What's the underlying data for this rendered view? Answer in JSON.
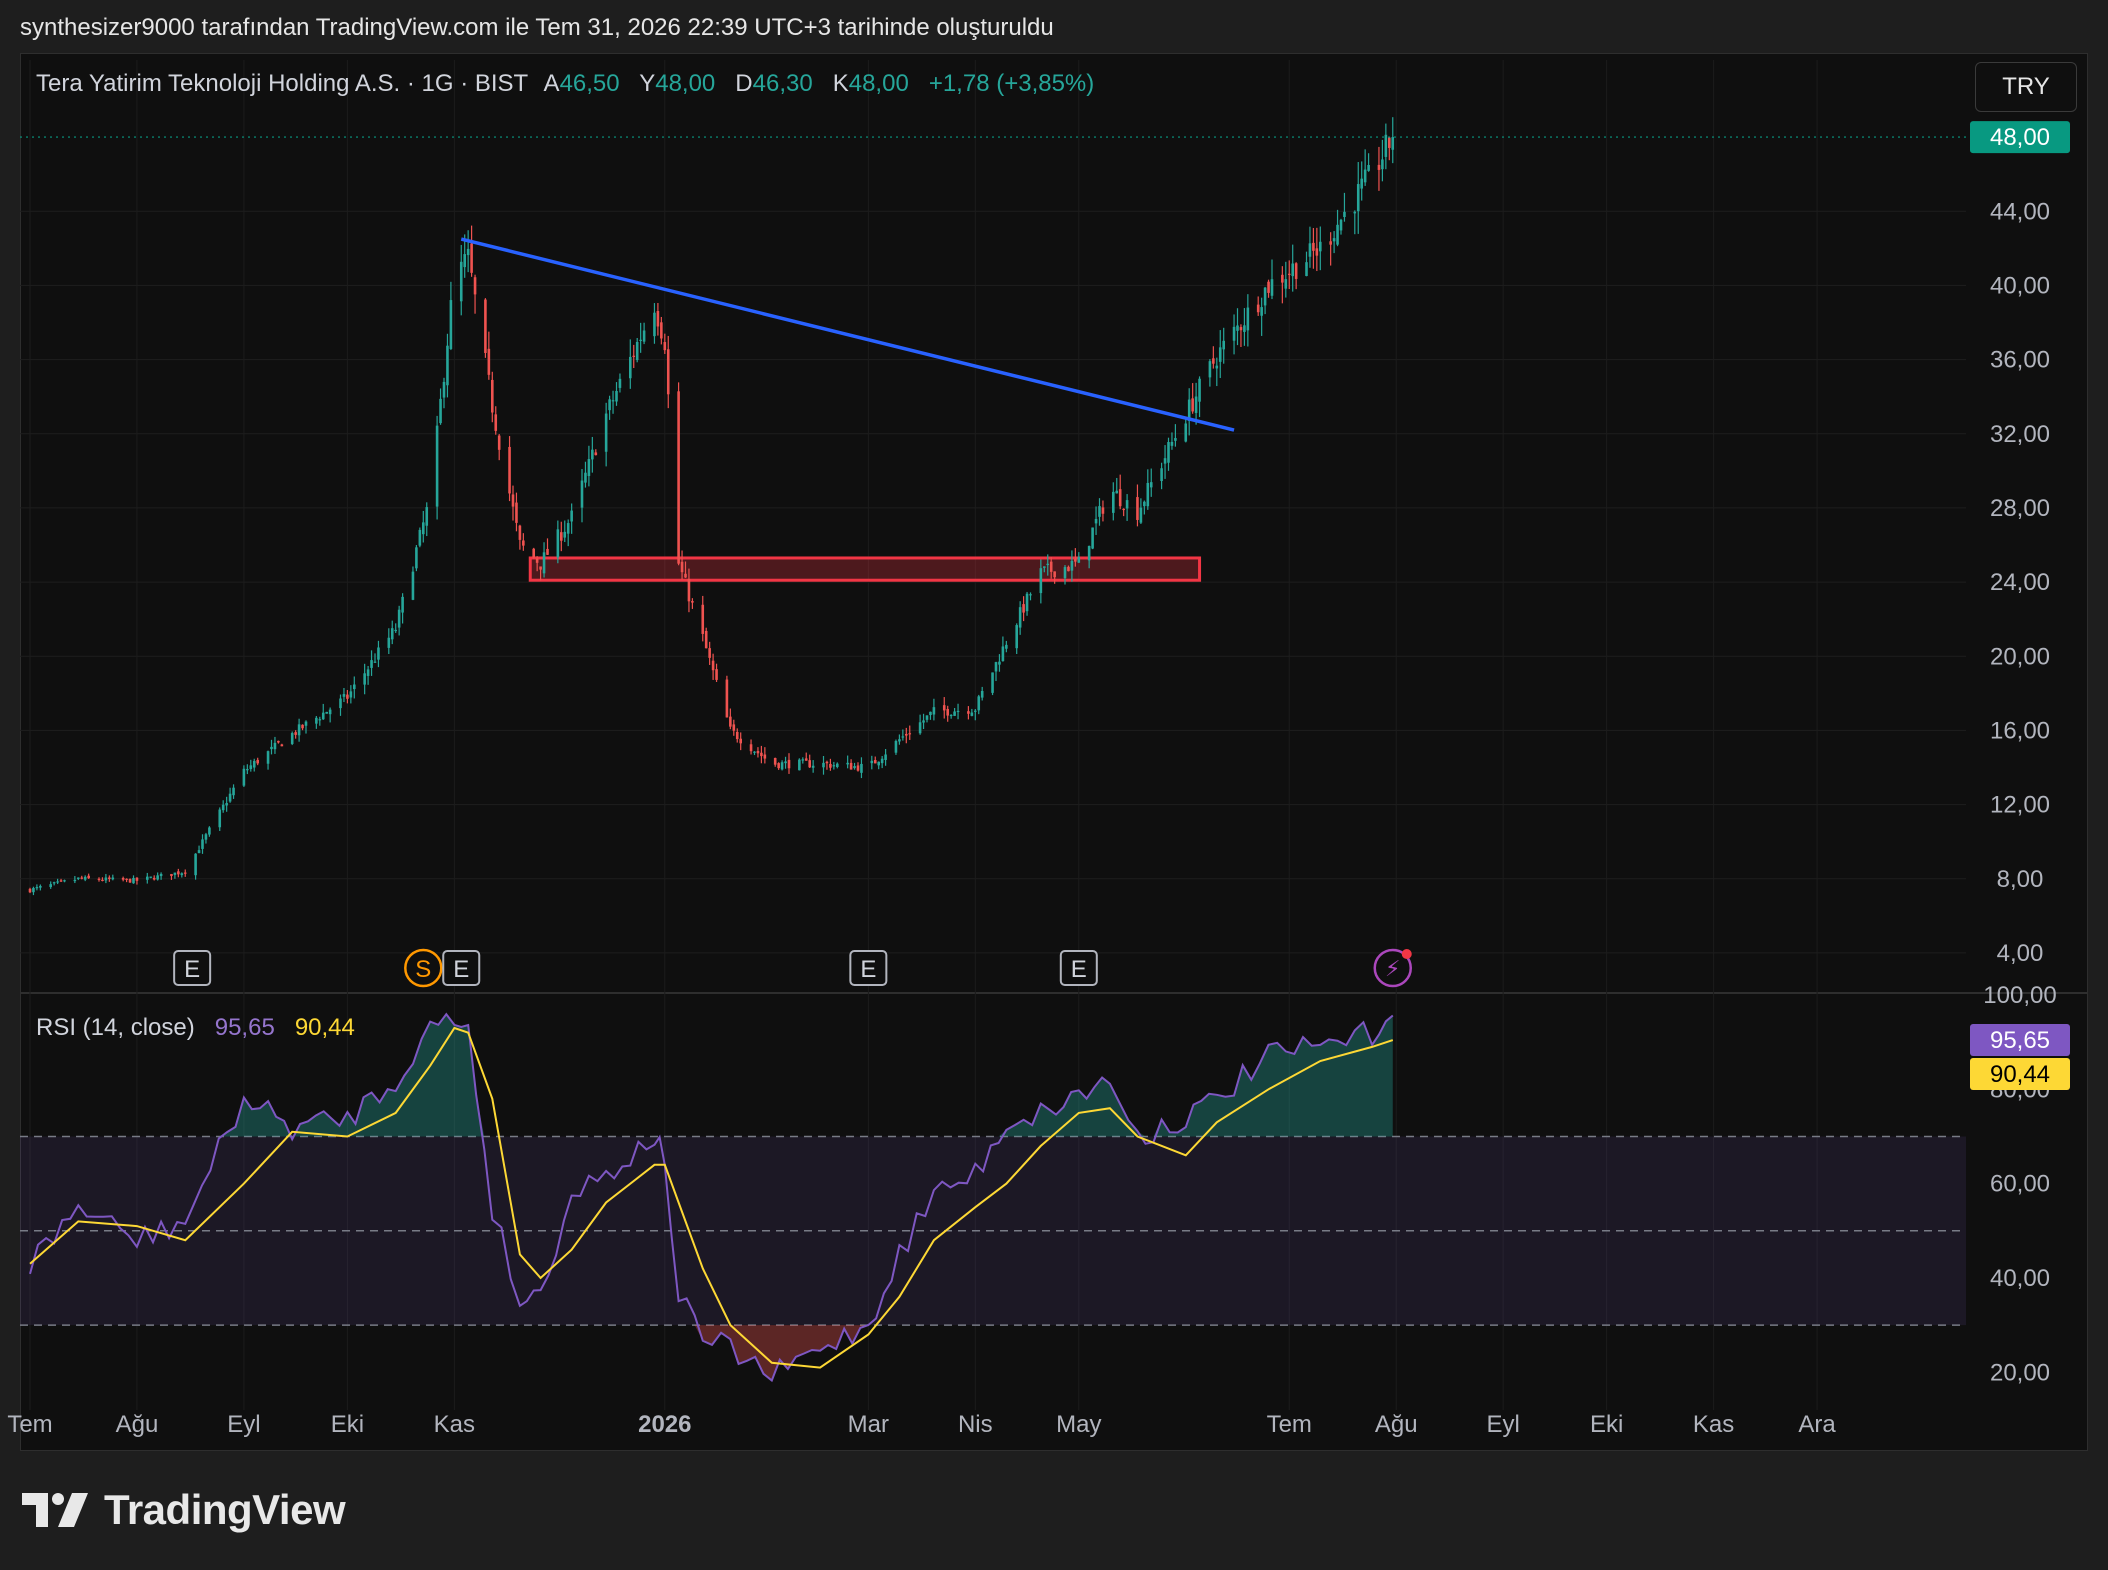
{
  "caption": "synthesizer9000 tarafından TradingView.com ile Tem 31, 2026 22:39 UTC+3 tarihinde oluşturuldu",
  "legend": {
    "title": "Tera Yatirim Teknoloji Holding A.S. · 1G · BIST",
    "open_label": "A",
    "open": "46,50",
    "high_label": "Y",
    "high": "48,00",
    "low_label": "D",
    "low": "46,30",
    "close_label": "K",
    "close": "48,00",
    "change": "+1,78 (+3,85%)"
  },
  "currency_button": "TRY",
  "rsi_legend": {
    "label": "RSI (14, close)",
    "rsi": "95,65",
    "ma": "90,44"
  },
  "brand": "TradingView",
  "colors": {
    "up": "#26a69a",
    "down": "#ef5350",
    "trendline": "#2962ff",
    "zone": "#f23645",
    "rsi": "#7e57c2",
    "rsi_ma": "#fdd835",
    "price_tag": "#089981"
  },
  "chart_data": [
    {
      "type": "candlestick",
      "title": "Tera Yatirim Teknoloji Holding A.S. · 1G · BIST",
      "ylim": [
        2,
        50
      ],
      "y_ticks": [
        "4,00",
        "8,00",
        "12,00",
        "16,00",
        "20,00",
        "24,00",
        "28,00",
        "32,00",
        "36,00",
        "40,00",
        "44,00"
      ],
      "last_price": "48,00",
      "x_ticks": [
        "Tem",
        "Ağu",
        "Eyl",
        "Eki",
        "Kas",
        "2026",
        "Mar",
        "Nis",
        "May",
        "Tem",
        "Ağu",
        "Eyl",
        "Eki",
        "Kas",
        "Ara"
      ],
      "close_path": [
        [
          "2025-07-01",
          7.4
        ],
        [
          "2025-07-15",
          8.0
        ],
        [
          "2025-08-01",
          7.9
        ],
        [
          "2025-08-15",
          8.4
        ],
        [
          "2025-09-01",
          13.8
        ],
        [
          "2025-09-15",
          15.8
        ],
        [
          "2025-10-01",
          17.8
        ],
        [
          "2025-10-15",
          21.5
        ],
        [
          "2025-10-25",
          28.5
        ],
        [
          "2025-11-01",
          40.5
        ],
        [
          "2025-11-05",
          41.5
        ],
        [
          "2025-11-12",
          33.5
        ],
        [
          "2025-11-20",
          26.0
        ],
        [
          "2025-11-26",
          25.0
        ],
        [
          "2025-12-05",
          27.5
        ],
        [
          "2025-12-15",
          33.0
        ],
        [
          "2025-12-29",
          39.0
        ],
        [
          "2026-01-01",
          37.0
        ],
        [
          "2026-01-05",
          25.0
        ],
        [
          "2026-01-12",
          21.0
        ],
        [
          "2026-01-20",
          16.0
        ],
        [
          "2026-02-01",
          14.2
        ],
        [
          "2026-02-15",
          14.2
        ],
        [
          "2026-03-01",
          14.0
        ],
        [
          "2026-03-10",
          15.5
        ],
        [
          "2026-03-20",
          17.0
        ],
        [
          "2026-04-01",
          17.2
        ],
        [
          "2026-04-10",
          20.8
        ],
        [
          "2026-04-20",
          24.5
        ],
        [
          "2026-05-01",
          25.0
        ],
        [
          "2026-05-10",
          29.0
        ],
        [
          "2026-05-18",
          27.8
        ],
        [
          "2026-06-01",
          33.0
        ],
        [
          "2026-06-10",
          36.2
        ],
        [
          "2026-06-25",
          40.0
        ],
        [
          "2026-07-10",
          42.0
        ],
        [
          "2026-07-25",
          46.0
        ],
        [
          "2026-07-31",
          48.0
        ]
      ],
      "annotations": {
        "trendline": {
          "from": [
            "2025-11-03",
            42.5
          ],
          "to": [
            "2026-06-15",
            32.2
          ]
        },
        "support_zone": {
          "from": "2025-11-23",
          "to": "2026-06-05",
          "low": 24.1,
          "high": 25.3
        },
        "events": [
          {
            "label": "E",
            "date": "2025-08-17"
          },
          {
            "label": "S",
            "date": "2025-10-23"
          },
          {
            "label": "E",
            "date": "2025-11-03"
          },
          {
            "label": "E",
            "date": "2026-03-01"
          },
          {
            "label": "E",
            "date": "2026-05-01"
          },
          {
            "label": "⚡",
            "date": "2026-07-31"
          }
        ]
      }
    },
    {
      "type": "line",
      "title": "RSI (14, close)",
      "ylim": [
        12,
        100
      ],
      "y_ticks": [
        "20,00",
        "40,00",
        "60,00",
        "80,00",
        "100,00"
      ],
      "bands": {
        "upper": 70,
        "middle": 50,
        "lower": 30
      },
      "series": [
        {
          "name": "RSI",
          "last": "95,65",
          "values": [
            [
              "2025-07-01",
              43
            ],
            [
              "2025-07-15",
              55
            ],
            [
              "2025-08-01",
              48
            ],
            [
              "2025-08-15",
              52
            ],
            [
              "2025-09-01",
              78
            ],
            [
              "2025-09-15",
              72
            ],
            [
              "2025-10-01",
              74
            ],
            [
              "2025-10-15",
              82
            ],
            [
              "2025-10-25",
              93
            ],
            [
              "2025-11-01",
              95
            ],
            [
              "2025-11-05",
              93
            ],
            [
              "2025-11-12",
              55
            ],
            [
              "2025-11-20",
              35
            ],
            [
              "2025-11-26",
              37
            ],
            [
              "2025-12-05",
              58
            ],
            [
              "2025-12-15",
              62
            ],
            [
              "2025-12-29",
              70
            ],
            [
              "2026-01-01",
              65
            ],
            [
              "2026-01-05",
              36
            ],
            [
              "2026-01-12",
              27
            ],
            [
              "2026-01-20",
              25
            ],
            [
              "2026-02-01",
              19
            ],
            [
              "2026-02-15",
              25
            ],
            [
              "2026-03-01",
              30
            ],
            [
              "2026-03-10",
              45
            ],
            [
              "2026-03-20",
              58
            ],
            [
              "2026-04-01",
              62
            ],
            [
              "2026-04-10",
              73
            ],
            [
              "2026-04-20",
              75
            ],
            [
              "2026-05-01",
              79
            ],
            [
              "2026-05-10",
              82
            ],
            [
              "2026-05-18",
              70
            ],
            [
              "2026-06-01",
              74
            ],
            [
              "2026-06-10",
              78
            ],
            [
              "2026-06-25",
              87
            ],
            [
              "2026-07-10",
              89
            ],
            [
              "2026-07-25",
              92
            ],
            [
              "2026-07-31",
              95.65
            ]
          ]
        },
        {
          "name": "RSI MA",
          "last": "90,44",
          "values": [
            [
              "2025-07-01",
              43
            ],
            [
              "2025-07-15",
              52
            ],
            [
              "2025-08-01",
              51
            ],
            [
              "2025-08-15",
              48
            ],
            [
              "2025-09-01",
              60
            ],
            [
              "2025-09-15",
              71
            ],
            [
              "2025-10-01",
              70
            ],
            [
              "2025-10-15",
              75
            ],
            [
              "2025-10-25",
              85
            ],
            [
              "2025-11-01",
              93
            ],
            [
              "2025-11-05",
              92
            ],
            [
              "2025-11-12",
              78
            ],
            [
              "2025-11-20",
              45
            ],
            [
              "2025-11-26",
              40
            ],
            [
              "2025-12-05",
              46
            ],
            [
              "2025-12-15",
              56
            ],
            [
              "2025-12-29",
              64
            ],
            [
              "2026-01-01",
              64
            ],
            [
              "2026-01-05",
              56
            ],
            [
              "2026-01-12",
              42
            ],
            [
              "2026-01-20",
              30
            ],
            [
              "2026-02-01",
              22
            ],
            [
              "2026-02-15",
              21
            ],
            [
              "2026-03-01",
              28
            ],
            [
              "2026-03-10",
              36
            ],
            [
              "2026-03-20",
              48
            ],
            [
              "2026-04-01",
              55
            ],
            [
              "2026-04-10",
              60
            ],
            [
              "2026-04-20",
              68
            ],
            [
              "2026-05-01",
              75
            ],
            [
              "2026-05-10",
              76
            ],
            [
              "2026-05-18",
              70
            ],
            [
              "2026-06-01",
              66
            ],
            [
              "2026-06-10",
              73
            ],
            [
              "2026-06-25",
              80
            ],
            [
              "2026-07-10",
              86
            ],
            [
              "2026-07-25",
              89
            ],
            [
              "2026-07-31",
              90.44
            ]
          ]
        }
      ]
    }
  ]
}
